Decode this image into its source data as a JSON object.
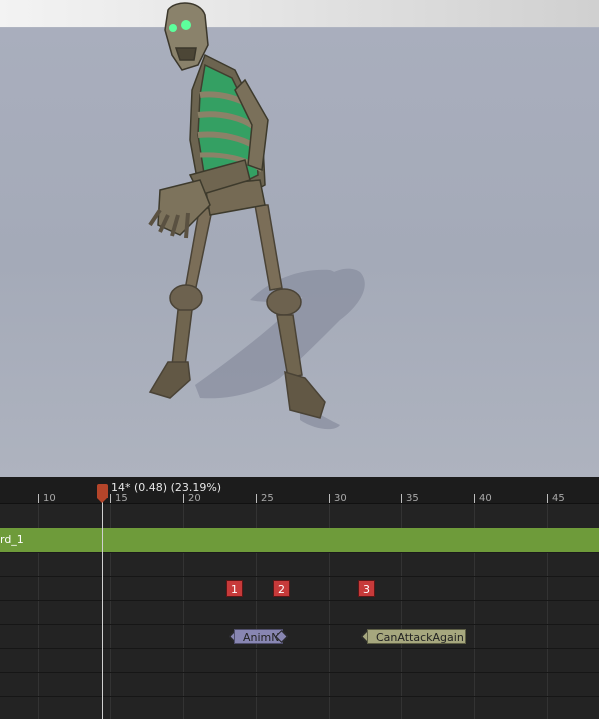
{
  "viewport": {
    "character": "skeleton",
    "background_color": "#a6acba"
  },
  "timeline": {
    "playhead_label": "14* (0.48) (23.19%)",
    "ruler_ticks": [
      "10",
      "15",
      "20",
      "25",
      "30",
      "35",
      "40",
      "45"
    ],
    "tracks": {
      "anim_track_label": "rd_1"
    },
    "markers": [
      "1",
      "2",
      "3"
    ],
    "notifies": [
      {
        "label": "AnimN",
        "color": "#8886b2"
      },
      {
        "label": "CanAttackAgain",
        "color": "#a6a77e"
      }
    ],
    "accent_colors": {
      "track": "#6e9b3a",
      "marker": "#c73a3a",
      "playhead": "#b5452a"
    }
  }
}
